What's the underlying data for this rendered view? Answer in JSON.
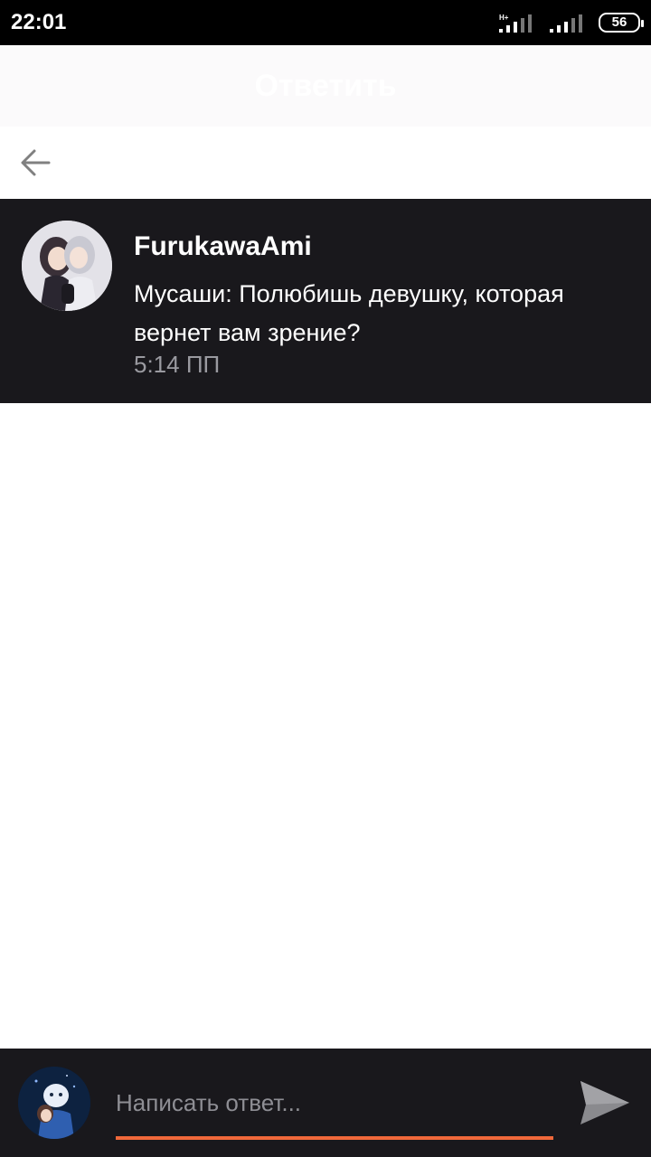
{
  "status_bar": {
    "time": "22:01",
    "network": "H+",
    "battery": "56"
  },
  "header": {
    "title": "Ответить"
  },
  "message": {
    "username": "FurukawaAmi",
    "text": "Мусаши: Полюбишь девушку, которая вернет вам зрение?",
    "time": "5:14 ПП"
  },
  "reply": {
    "placeholder": "Написать ответ...",
    "accent_color": "#f0683a"
  },
  "icons": {
    "back": "arrow-left-icon",
    "send": "send-icon"
  }
}
